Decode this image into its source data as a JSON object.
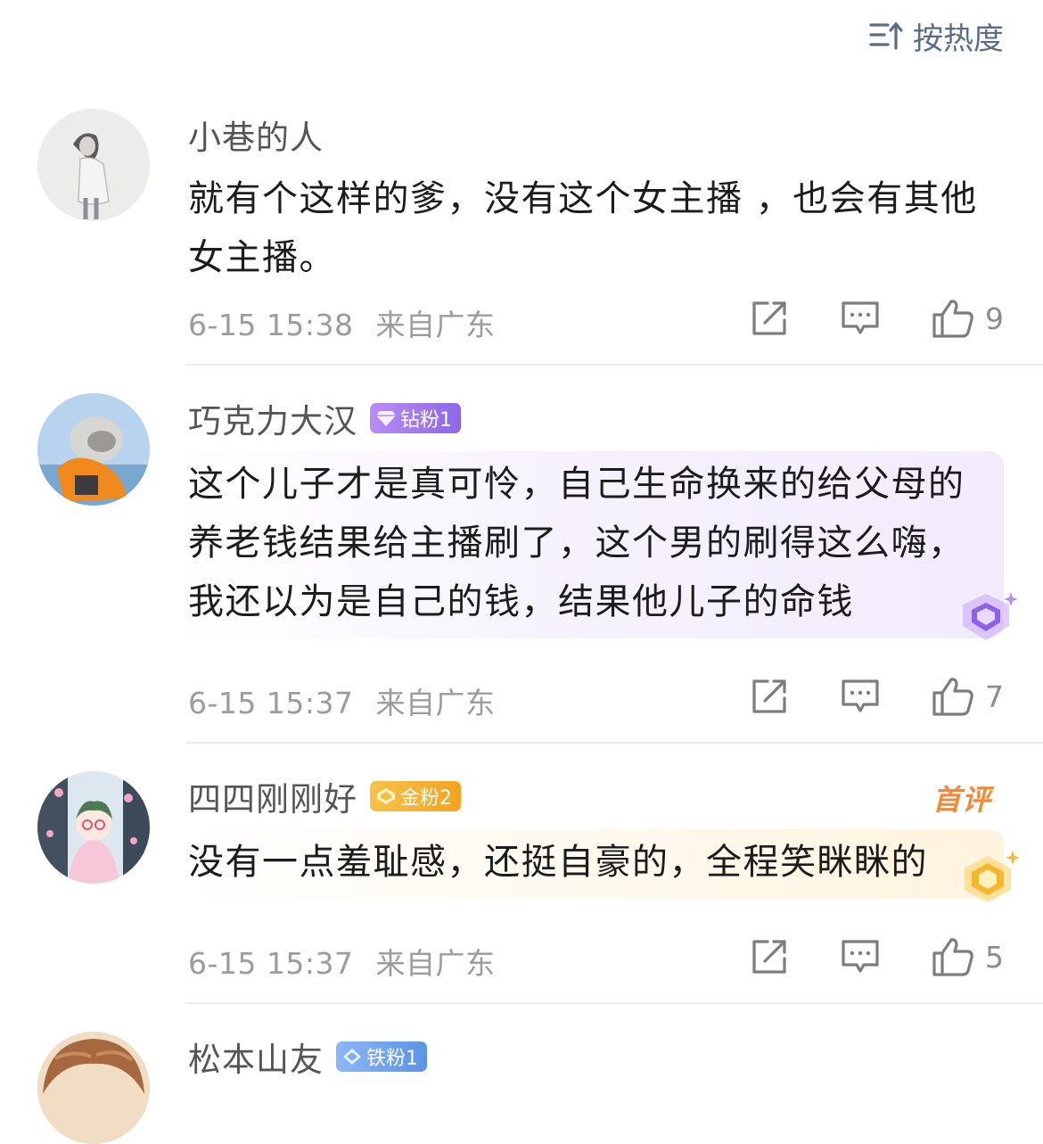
{
  "sort": {
    "label": "按热度",
    "icon": "sort-icon"
  },
  "comments": [
    {
      "name": "小巷的人",
      "badge": null,
      "text": "就有个这样的爹，没有这个女主播 ，也会有其他女主播。",
      "time": "6-15 15:38",
      "location": "来自广东",
      "likes": "9"
    },
    {
      "name": "巧克力大汉",
      "badge": {
        "label": "钻粉1",
        "type": "diamond",
        "color": "#a57af0"
      },
      "text": "这个儿子才是真可怜，自己生命换来的给父母的养老钱结果给主播刷了，这个男的刷得这么嗨，我还以为是自己的钱，结果他儿子的命钱",
      "time": "6-15 15:37",
      "location": "来自广东",
      "likes": "7"
    },
    {
      "name": "四四刚刚好",
      "badge": {
        "label": "金粉2",
        "type": "gold",
        "color": "#f5b132"
      },
      "tag": "首评",
      "text": "没有一点羞耻感，还挺自豪的，全程笑眯眯的",
      "time": "6-15 15:37",
      "location": "来自广东",
      "likes": "5"
    },
    {
      "name": "松本山友",
      "badge": {
        "label": "铁粉1",
        "type": "iron",
        "color": "#6fa0ea"
      }
    }
  ]
}
